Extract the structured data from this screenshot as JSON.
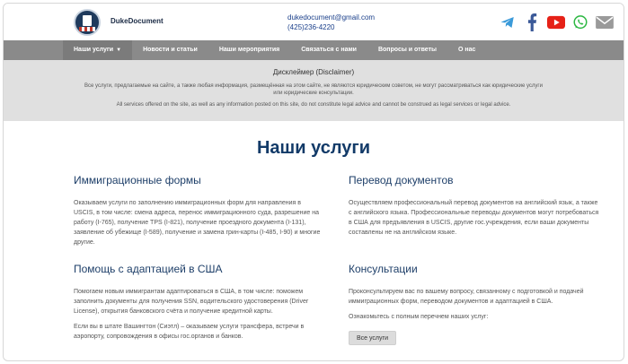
{
  "header": {
    "brand": "DukeDocument",
    "email": "dukedocument@gmail.com",
    "phone": "(425)236-4220"
  },
  "socials": [
    "telegram-icon",
    "facebook-icon",
    "youtube-icon",
    "whatsapp-icon",
    "email-icon"
  ],
  "colors": {
    "nav_bg": "#8a8a8a",
    "title": "#123a68",
    "heading": "#1e3f69",
    "disclaimer_bg": "#e0e0e0"
  },
  "nav": {
    "items": [
      {
        "label": "Наши услуги"
      },
      {
        "label": "Новости и статьи"
      },
      {
        "label": "Наши мероприятия"
      },
      {
        "label": "Связаться с нами"
      },
      {
        "label": "Вопросы и ответы"
      },
      {
        "label": "О нас"
      }
    ]
  },
  "disclaimer": {
    "title": "Дисклеймер (Disclaimer)",
    "ru": "Все услуги, предлагаемые на сайте, а также любая информация, размещённая на этом сайте, не являются юридическим советом, не могут рассматриваться как юридические услуги или юридические консультации.",
    "en": "All services offered on the site, as well as any information posted on this site, do not constitute legal advice and cannot be construed as legal services or legal advice."
  },
  "main": {
    "title": "Наши услуги",
    "services": [
      {
        "heading": "Иммиграционные формы",
        "paragraphs": [
          "Оказываем услуги по заполнению иммиграционных форм для направления в USCIS, в том числе: смена адреса, перенос иммиграционного суда, разрешение на работу (I-765), получение TPS (I-821), получение проездного документа (I-131), заявление об убежище (I-589), получение и замена грин-карты (I-485, I-90) и многие другие."
        ]
      },
      {
        "heading": "Перевод документов",
        "paragraphs": [
          "Осуществляем профессиональный перевод документов на английский язык, а также с английского языка. Профессиональные переводы документов могут потребоваться в США для предъявления в USCIS, другие гос.учреждения, если ваши документы составлены не на английском языке."
        ]
      },
      {
        "heading": "Помощь с адаптацией в США",
        "paragraphs": [
          "Помогаем новым иммигрантам адаптироваться в США, в том числе: поможем заполнить документы для получения SSN, водительского удостоверения (Driver License), открытия банковского счёта и получение кредитной карты.",
          "Если вы в штате Вашингтон (Сиэтл) – оказываем услуги трансфера, встречи в аэропорту, сопровождения в офисы гос.органов и банков."
        ]
      },
      {
        "heading": "Консультации",
        "paragraphs": [
          "Проконсультируем вас по вашему вопросу, связанному с подготовкой и подачей иммиграционных форм, переводом документов и адаптацией в США.",
          "Ознакомьтесь с полным перечнем наших услуг:"
        ],
        "button": "Все услуги"
      }
    ]
  }
}
